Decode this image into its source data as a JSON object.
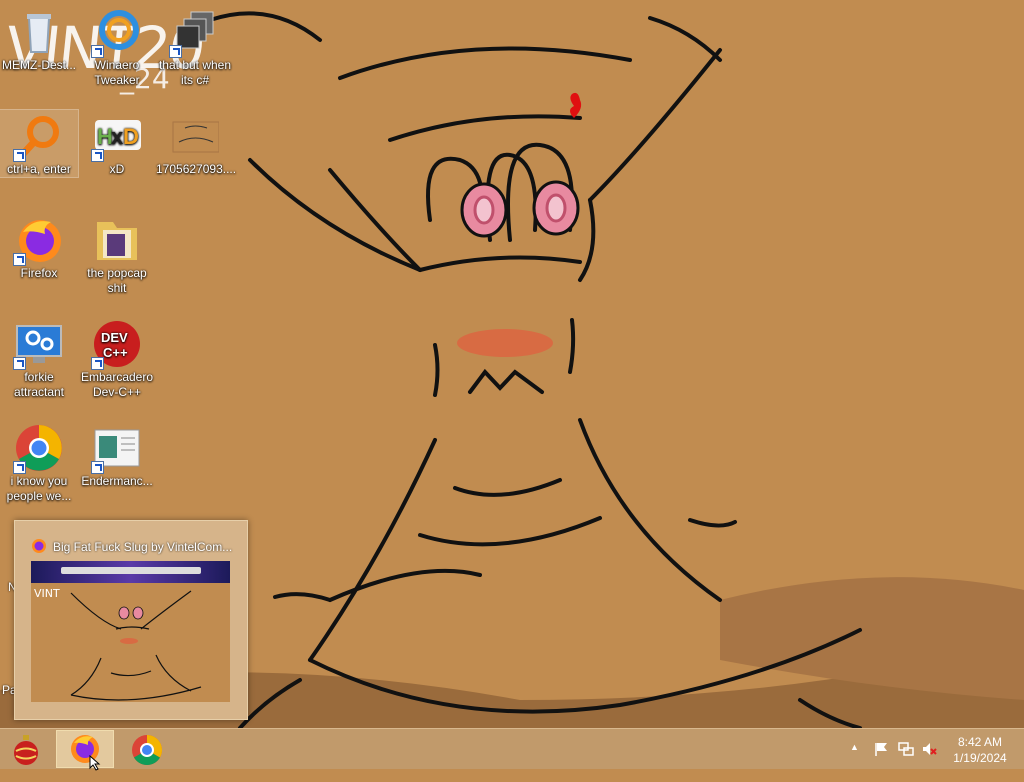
{
  "desktop": {
    "watermark_main": "VINT20",
    "watermark_sub": "_24",
    "icons": [
      {
        "label": "MEMZ-Dest...",
        "icon": "recycle-bin-icon"
      },
      {
        "label": "Winaero Tweaker",
        "icon": "winaero-tweaker-icon"
      },
      {
        "label": "that but when its c#",
        "icon": "window-stack-icon"
      },
      {
        "label": "ctrl+a, enter",
        "icon": "magnifier-icon"
      },
      {
        "label": "xD",
        "icon": "hxd-icon"
      },
      {
        "label": "1705627093....",
        "icon": "image-thumbnail-icon"
      },
      {
        "label": "Firefox",
        "icon": "firefox-icon"
      },
      {
        "label": "the popcap shit",
        "icon": "folder-icon"
      },
      {
        "label": "forkie attractant",
        "icon": "monitor-settings-icon"
      },
      {
        "label": "Embarcadero Dev-C++",
        "icon": "dev-cpp-icon"
      },
      {
        "label": "i know you people we...",
        "icon": "chrome-icon"
      },
      {
        "label": "Endermanc...",
        "icon": "document-window-icon"
      }
    ],
    "cut_labels": {
      "left_a": "N",
      "left_b": "Pa"
    }
  },
  "taskbar_preview": {
    "title": "Big Fat Fuck Slug by VintelCom...",
    "thumb_watermark": "VINT"
  },
  "taskbar": {
    "buttons": [
      {
        "name": "ornament-app",
        "icon": "christmas-ornament-icon"
      },
      {
        "name": "firefox",
        "icon": "firefox-icon"
      },
      {
        "name": "chrome",
        "icon": "chrome-icon"
      }
    ],
    "tray": {
      "icons": [
        "show-hidden-icons-chevron-icon",
        "action-center-flag-icon",
        "network-icon",
        "volume-muted-icon"
      ],
      "chevron": "▲"
    },
    "clock": {
      "time": "8:42 AM",
      "date": "1/19/2024"
    }
  },
  "colors": {
    "wallpaper": "#c18c50",
    "taskbar": "#c19a6b",
    "eye_pink": "#e88aa0",
    "blush": "#e8553a"
  }
}
